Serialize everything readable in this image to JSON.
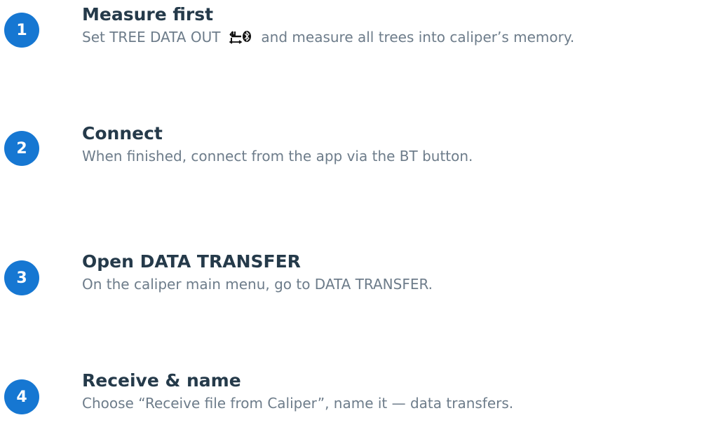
{
  "theme": {
    "accent": "#1677d2",
    "title_color": "#253a4a",
    "text_color": "#6d7c8a"
  },
  "steps": [
    {
      "number": "1",
      "title": "Measure first",
      "desc_before": "Set TREE DATA OUT",
      "desc_icon": "tree-data-out-bluetooth-icon",
      "desc_after": "and measure all trees into caliper’s memory."
    },
    {
      "number": "2",
      "title": "Connect",
      "desc": "When finished, connect from the app via the BT button."
    },
    {
      "number": "3",
      "title": "Open DATA TRANSFER",
      "desc": "On the caliper main menu, go to DATA TRANSFER."
    },
    {
      "number": "4",
      "title": "Receive & name",
      "desc": "Choose “Receive file from Caliper”, name it — data transfers."
    }
  ]
}
